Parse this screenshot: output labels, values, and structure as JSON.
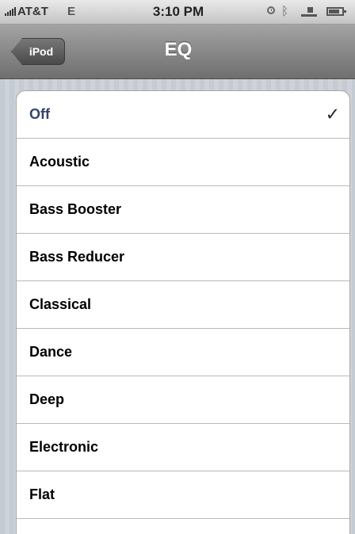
{
  "status_bar": {
    "carrier": "AT&T",
    "network": "E",
    "time": "3:10 PM",
    "icons": [
      "signal-icon",
      "alarm-icon",
      "bluetooth-icon",
      "lock-icon",
      "battery-icon"
    ]
  },
  "nav": {
    "back_label": "iPod",
    "title": "EQ"
  },
  "eq_list": {
    "selected": "Off",
    "items": [
      "Off",
      "Acoustic",
      "Bass Booster",
      "Bass Reducer",
      "Classical",
      "Dance",
      "Deep",
      "Electronic",
      "Flat"
    ]
  },
  "colors": {
    "nav_bar": "#8b8b8b",
    "selected_text": "#32436b",
    "background_stripes": "#c5cbd2"
  }
}
